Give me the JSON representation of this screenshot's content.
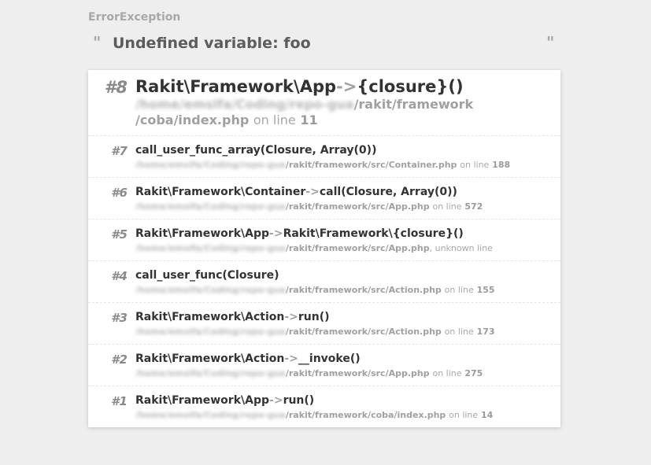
{
  "exception": {
    "type": "ErrorException",
    "open_quote": "\"",
    "close_quote": "\"",
    "message": "Undefined variable: foo"
  },
  "trace": [
    {
      "num": "#8",
      "call_parts": [
        "Rakit\\Framework\\App",
        "->",
        "{closure}()"
      ],
      "path_blurred": "/home/emsifa/Coding/repo-gua",
      "path_visible_1": "/rakit/framework",
      "path_visible_2": "/coba/index.php",
      "on_line": "on line",
      "line": "11"
    },
    {
      "num": "#7",
      "call_parts": [
        "call_user_func_array(Closure, Array(0))",
        "",
        ""
      ],
      "path_blurred": "/home/emsifa/Coding/repo-gua",
      "path_visible": "/rakit/framework/src/Container.php",
      "on_line": "on line",
      "line": "188"
    },
    {
      "num": "#6",
      "call_parts": [
        "Rakit\\Framework\\Container",
        "->",
        "call(Closure, Array(0))"
      ],
      "path_blurred": "/home/emsifa/Coding/repo-gua",
      "path_visible": "/rakit/framework/src/App.php",
      "on_line": "on line",
      "line": "572"
    },
    {
      "num": "#5",
      "call_parts": [
        "Rakit\\Framework\\App",
        "->",
        "Rakit\\Framework\\{closure}()"
      ],
      "path_blurred": "/home/emsifa/Coding/repo-gua",
      "path_visible": "/rakit/framework/src/App.php",
      "on_line": ", unknown line",
      "line": ""
    },
    {
      "num": "#4",
      "call_parts": [
        "call_user_func(Closure)",
        "",
        ""
      ],
      "path_blurred": "/home/emsifa/Coding/repo-gua",
      "path_visible": "/rakit/framework/src/Action.php",
      "on_line": "on line",
      "line": "155"
    },
    {
      "num": "#3",
      "call_parts": [
        "Rakit\\Framework\\Action",
        "->",
        "run()"
      ],
      "path_blurred": "/home/emsifa/Coding/repo-gua",
      "path_visible": "/rakit/framework/src/Action.php",
      "on_line": "on line",
      "line": "173"
    },
    {
      "num": "#2",
      "call_parts": [
        "Rakit\\Framework\\Action",
        "->",
        "__invoke()"
      ],
      "path_blurred": "/home/emsifa/Coding/repo-gua",
      "path_visible": "/rakit/framework/src/App.php",
      "on_line": "on line",
      "line": "275"
    },
    {
      "num": "#1",
      "call_parts": [
        "Rakit\\Framework\\App",
        "->",
        "run()"
      ],
      "path_blurred": "/home/emsifa/Coding/repo-gua",
      "path_visible": "/rakit/framework/coba/index.php",
      "on_line": "on line",
      "line": "14"
    }
  ]
}
